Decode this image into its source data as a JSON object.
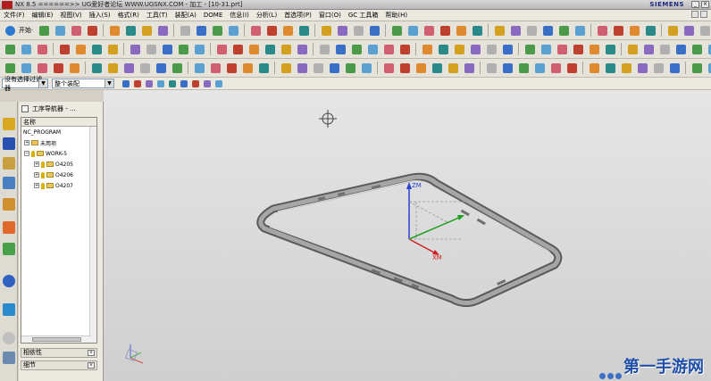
{
  "titlebar": {
    "title": "NX 8.5 ======>> UG爱好者论坛 WWW.UGSNX.COM - 加工 - [10-31.prt]",
    "brand": "SIEMENS",
    "minimize": "_",
    "close": "×"
  },
  "menu": {
    "items": [
      "文件(F)",
      "编辑(E)",
      "视图(V)",
      "插入(S)",
      "格式(R)",
      "工具(T)",
      "装配(A)",
      "DOME",
      "信息(I)",
      "分析(L)",
      "首选项(P)",
      "窗口(O)",
      "GC 工具箱",
      "帮助(H)"
    ]
  },
  "toolbar1": {
    "start_label": "开始·"
  },
  "selection": {
    "filter": "没有选择过滤器",
    "scope": "整个装配"
  },
  "navigator": {
    "title": "工序导航器 - ...",
    "column": "名称",
    "rows": [
      "NC_PROGRAM",
      "未用项",
      "WORK-5",
      "O4205",
      "O4206",
      "O4207"
    ],
    "panels": [
      "相依性",
      "细节"
    ]
  },
  "graphics": {
    "axis_zm": "ZM",
    "axis_xm": "XM",
    "watermark": "第一手游网"
  },
  "colors": {
    "accent": "#1f4fa8",
    "brand": "#1a2a80",
    "axis_z": "#2a40d0",
    "axis_x": "#d02020",
    "axis_y": "#20a020"
  }
}
